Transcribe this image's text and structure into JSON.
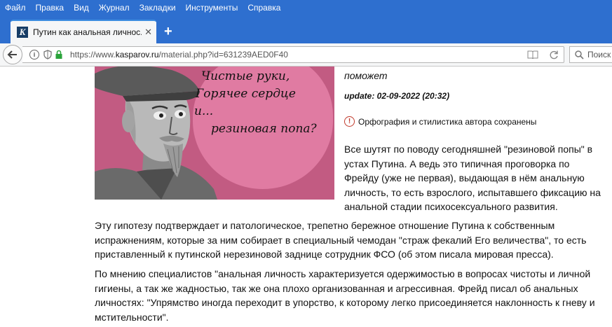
{
  "menu": [
    "Файл",
    "Правка",
    "Вид",
    "Журнал",
    "Закладки",
    "Инструменты",
    "Справка"
  ],
  "tab": {
    "favicon_letter": "K",
    "title": "Путин как анальная личнос..."
  },
  "navbar": {
    "url_prefix": "https://www.",
    "url_domain": "kasparov.ru",
    "url_rest": "/material.php?id=631239AED0F40",
    "search_placeholder": "Поиск"
  },
  "article": {
    "image_caption": [
      "Чистые руки,",
      "Горячее сердце",
      "и...",
      "резиновая попа?"
    ],
    "title_tail": "поможет",
    "update": "update: 02-09-2022 (20:32)",
    "notice": "Орфография и стилистика автора сохранены",
    "para1_lines": [
      "Все шутят по поводу сегодняшней \"резиновой попы\" в",
      "устах Путина. А ведь это типичная проговорка по",
      "Фрейду (уже не первая), выдающая в нём анальную",
      "личность, то есть взрослого, испытавшего фиксацию на",
      "анальной стадии психосексуального развития."
    ],
    "para2_lines": [
      "Эту гипотезу подтверждает и патологическое, трепетно бережное отношение Путина к собственным",
      "испражнениям, которые за ним собирает в специальный чемодан \"страж фекалий Его величества\", то есть",
      "приставленный к путинской нерезиновой заднице сотрудник ФСО (об этом писала мировая пресса)."
    ],
    "para3_lines": [
      "По мнению специалистов \"анальная личность характеризуется одержимостью в вопросах чистоты и личной",
      "гигиены, а так же жадностью, так же она плохо организованная и агрессивная. Фрейд писал об анальных",
      "личностях: \"Упрямство иногда переходит в упорство, к которому легко присоединяется наклонность к гневу и",
      "мстительности\"."
    ]
  }
}
